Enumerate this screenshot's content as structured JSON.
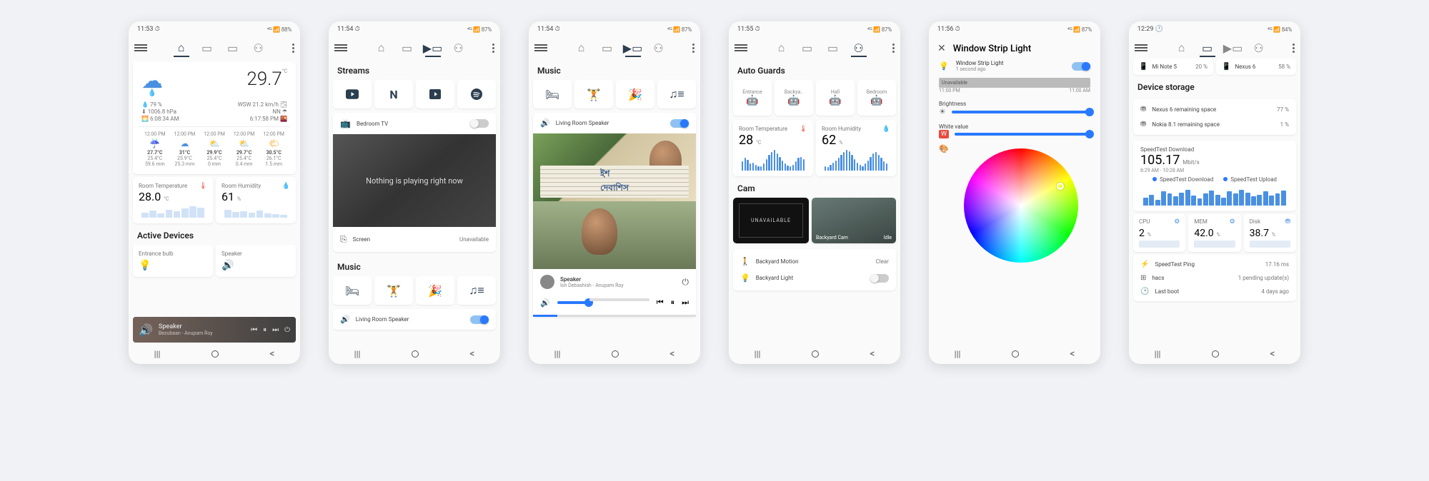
{
  "status": {
    "p1": {
      "time": "11:53 ⏱",
      "right": "⁴ᴳ 📶 88%"
    },
    "p2": {
      "time": "11:54 ⏱",
      "right": "⁴ᴳ 📶 87%"
    },
    "p3": {
      "time": "11:54 ⏱",
      "right": "⁴ᴳ 📶 87%"
    },
    "p4": {
      "time": "11:55 ⏱",
      "right": "⁴ᴳ 📶 87%"
    },
    "p5": {
      "time": "11:56 ⏱",
      "right": "⁴ᴳ 📶 87%"
    },
    "p6": {
      "time": "12:29 🕐",
      "right": "⁴ᴳ 📶 84%"
    }
  },
  "p1": {
    "temp": "29.7",
    "temp_unit": "°C",
    "humidity": "79 %",
    "pressure": "1006.8 hPa",
    "sunrise": "6:08:34 AM",
    "wind": "WSW 21.2 km/h",
    "rain": "NN",
    "sunset": "6:17:58 PM",
    "hours": [
      "12:00 PM",
      "12:00 PM",
      "12:00 PM",
      "12:00 PM",
      "12:00 PM"
    ],
    "forecast": [
      {
        "hi": "27.7°C",
        "lo": "25.4°C",
        "rain": "59.6 mm"
      },
      {
        "hi": "31°C",
        "lo": "25.9°C",
        "rain": "25.3 mm"
      },
      {
        "hi": "29.9°C",
        "lo": "25.4°C",
        "rain": "0 mm"
      },
      {
        "hi": "29.7°C",
        "lo": "25.4°C",
        "rain": "0.4 mm"
      },
      {
        "hi": "30.5°C",
        "lo": "26.1°C",
        "rain": "1.5 mm"
      }
    ],
    "room_temp_label": "Room Temperature",
    "room_temp": "28.0",
    "room_temp_unit": "°C",
    "room_hum_label": "Room Humidity",
    "room_hum": "61",
    "room_hum_unit": "%",
    "active_devices_title": "Active Devices",
    "dev1": "Entrance bulb",
    "dev2": "Speaker",
    "player_title": "Speaker",
    "player_sub": "Bezubaan - Anupam Roy"
  },
  "p2": {
    "streams_title": "Streams",
    "bedroom_tv": "Bedroom TV",
    "overlay": "Nothing is playing right now",
    "cast": "Screen",
    "cast_status": "Unavailable",
    "music_title": "Music",
    "living_speaker": "Living Room Speaker"
  },
  "p3": {
    "music_title": "Music",
    "living_speaker": "Living Room Speaker",
    "player_title": "Speaker",
    "player_sub": "Ish Debashish - Anupam Roy"
  },
  "p4": {
    "title": "Auto Guards",
    "guards": [
      "Entrance",
      "Backya..",
      "Hall",
      "Bedroom"
    ],
    "room_temp_label": "Room Temperature",
    "room_temp": "28",
    "room_temp_unit": "°C",
    "room_hum_label": "Room Humidity",
    "room_hum": "62",
    "room_hum_unit": "%",
    "cam_title": "Cam",
    "cam1": "UNAVAILABLE",
    "cam2a": "Backyard Cam",
    "cam2b": "Idle",
    "motion": "Backyard Motion",
    "motion_state": "Clear",
    "light": "Backyard Light"
  },
  "p5": {
    "title": "Window Strip Light",
    "sub": "1 second ago",
    "badge": "Unavailable",
    "time_l": "11:00 PM",
    "time_r": "11:00 AM",
    "brightness": "Brightness",
    "white": "White value"
  },
  "p6": {
    "dev1": "Mi Note 5",
    "dev1_pct": "20 %",
    "dev2": "Nexus 6",
    "dev2_pct": "58 %",
    "storage_title": "Device storage",
    "st1": "Nexus 6 remaining space",
    "st1_pct": "77 %",
    "st2": "Nokia 8.1 remaining space",
    "st2_pct": "1 %",
    "speed_title": "SpeedTest Download",
    "speed_val": "105.17",
    "speed_unit": "Mbit/s",
    "speed_time": "8:29 AM - 10:28 AM",
    "legend1": "SpeedTest Download",
    "legend2": "SpeedTest Upload",
    "cpu_label": "CPU",
    "cpu": "2",
    "cpu_unit": "%",
    "mem_label": "MEM",
    "mem": "42.0",
    "mem_unit": "%",
    "disk_label": "Disk",
    "disk": "38.7",
    "disk_unit": "%",
    "ping_label": "SpeedTest Ping",
    "ping": "17.16 ms",
    "hacs_label": "hacs",
    "hacs": "1 pending update(s)",
    "boot_label": "Last boot",
    "boot": "4 days ago"
  },
  "chart_data": {
    "type": "bar",
    "title": "Room Temperature / Humidity history graphs + SpeedTest bars (decorative sparklines, unlabeled)",
    "series": [
      {
        "name": "Room Temperature p4",
        "values": [
          18,
          22,
          20,
          14,
          16,
          12,
          10,
          8,
          12,
          20,
          26,
          28,
          30,
          26,
          22,
          18,
          14,
          10,
          8,
          6,
          10,
          14,
          20,
          24,
          22,
          20,
          18,
          16
        ]
      },
      {
        "name": "Room Humidity p4",
        "values": [
          8,
          6,
          10,
          12,
          14,
          16,
          20,
          24,
          26,
          28,
          30,
          28,
          24,
          18,
          14,
          10,
          8,
          6,
          8,
          12,
          16,
          20,
          24,
          26,
          24,
          20,
          16,
          12
        ]
      },
      {
        "name": "SpeedTest Download",
        "values": [
          40,
          55,
          30,
          70,
          60,
          45,
          65,
          80,
          50,
          35,
          60,
          75,
          55,
          40,
          70,
          60,
          80,
          65,
          45,
          55,
          70,
          50,
          60,
          75
        ]
      }
    ]
  }
}
